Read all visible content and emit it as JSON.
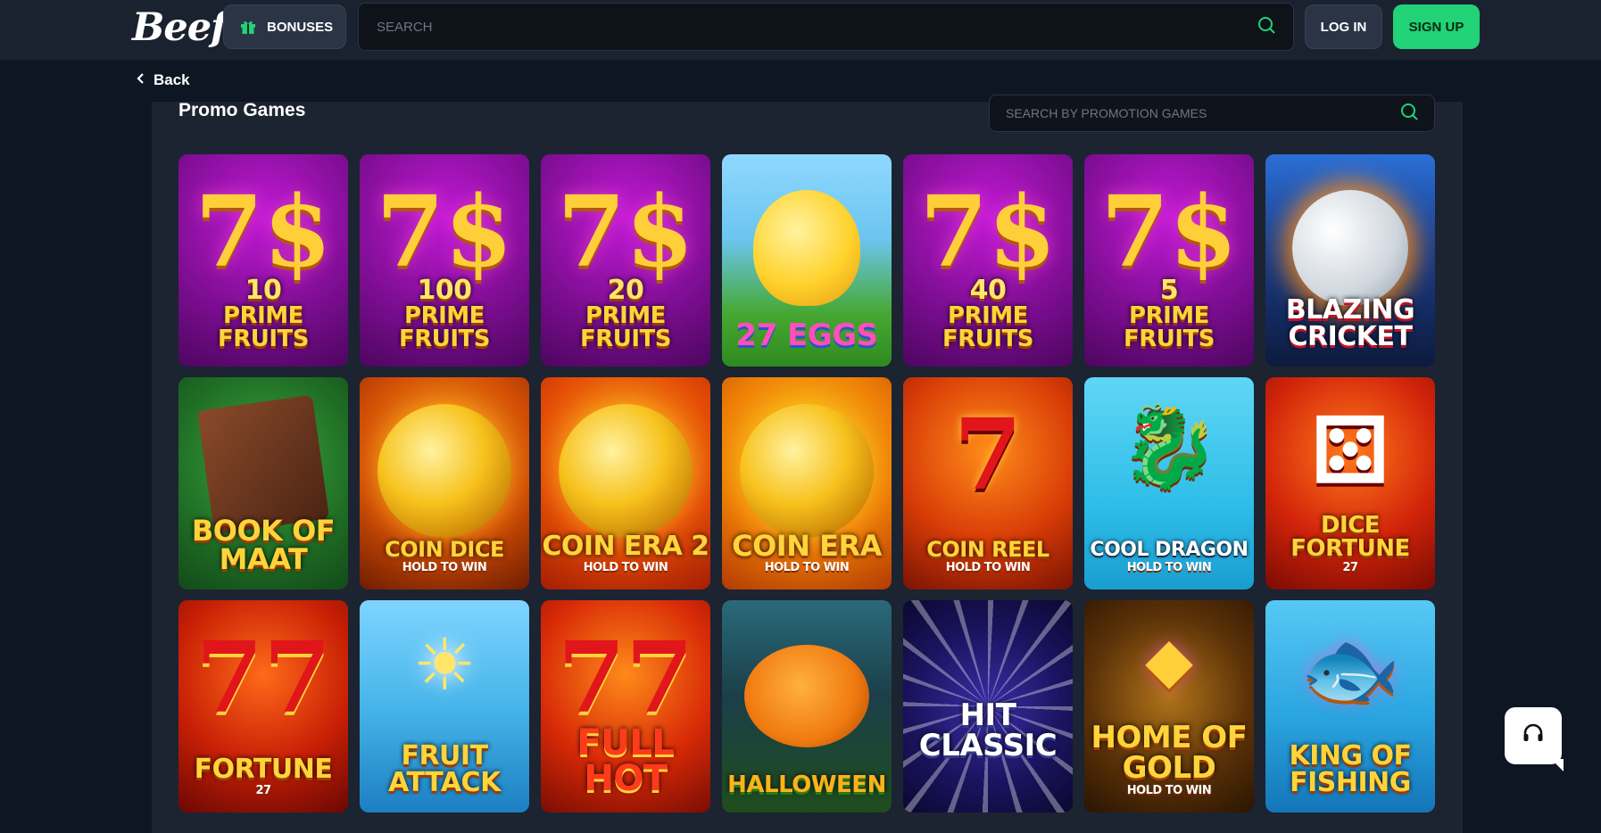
{
  "header": {
    "logo": "Beef",
    "bonuses_label": "BONUSES",
    "search_placeholder": "SEARCH",
    "login_label": "LOG IN",
    "signup_label": "SIGN UP"
  },
  "nav": {
    "back_label": "Back"
  },
  "promo": {
    "title": "Promo Games",
    "search_placeholder": "SEARCH BY PROMOTION GAMES"
  },
  "colors": {
    "accent": "#21d276",
    "background": "#0f1623",
    "header": "#1a2230",
    "panel": "#1c2331"
  },
  "icons": {
    "bonus": "gift-icon",
    "search": "search-icon",
    "back": "chevron-left-icon",
    "support": "headset-icon"
  },
  "games": [
    {
      "num": "10",
      "title": "PRIME FRUITS"
    },
    {
      "num": "100",
      "title": "PRIME FRUITS"
    },
    {
      "num": "20",
      "title": "PRIME FRUITS"
    },
    {
      "num": "",
      "title": "27 EGGS"
    },
    {
      "num": "40",
      "title": "PRIME FRUITS"
    },
    {
      "num": "5",
      "title": "PRIME FRUITS"
    },
    {
      "num": "",
      "title": "BLAZING CRICKET"
    },
    {
      "num": "",
      "title": "BOOK OF MAAT"
    },
    {
      "num": "",
      "title": "COIN DICE",
      "sub": "HOLD TO WIN"
    },
    {
      "num": "",
      "title": "COIN ERA 2",
      "sub": "HOLD TO WIN"
    },
    {
      "num": "",
      "title": "COIN ERA",
      "sub": "HOLD TO WIN"
    },
    {
      "num": "",
      "title": "COIN REEL",
      "sub": "HOLD TO WIN"
    },
    {
      "num": "",
      "title": "COOL DRAGON",
      "sub": "HOLD TO WIN"
    },
    {
      "num": "",
      "title": "DICE FORTUNE",
      "sub": "27"
    },
    {
      "num": "",
      "title": "FORTUNE",
      "sub": "27"
    },
    {
      "num": "",
      "title": "FRUIT ATTACK"
    },
    {
      "num": "",
      "title": "FULL HOT"
    },
    {
      "num": "",
      "title": "HALLOWEEN"
    },
    {
      "num": "",
      "title": "HIT CLASSIC"
    },
    {
      "num": "",
      "title": "HOME OF GOLD",
      "sub": "HOLD TO WIN"
    },
    {
      "num": "",
      "title": "KING OF FISHING"
    }
  ]
}
